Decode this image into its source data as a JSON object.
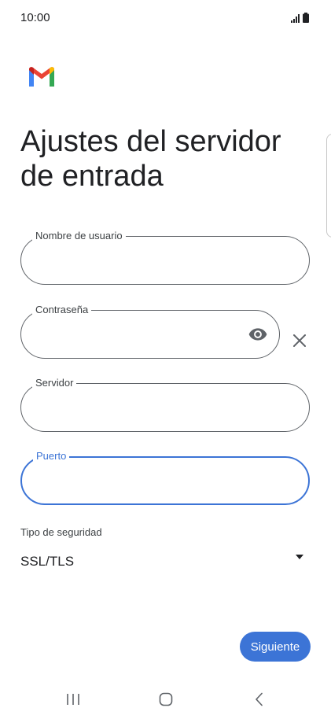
{
  "status_bar": {
    "time": "10:00"
  },
  "header": {
    "title": "Ajustes del servidor de entrada"
  },
  "form": {
    "username": {
      "label": "Nombre de usuario",
      "value": ""
    },
    "password": {
      "label": "Contraseña",
      "value": ""
    },
    "server": {
      "label": "Servidor",
      "value": ""
    },
    "port": {
      "label": "Puerto",
      "value": ""
    },
    "security": {
      "label": "Tipo de seguridad",
      "value": "SSL/TLS"
    }
  },
  "actions": {
    "next_label": "Siguiente"
  },
  "colors": {
    "accent": "#3c74d6",
    "border": "#5f6368",
    "text": "#202124"
  },
  "icons": {
    "gmail": "gmail-logo",
    "show_password": "eye-icon",
    "clear": "close-icon",
    "dropdown": "dropdown-icon"
  }
}
